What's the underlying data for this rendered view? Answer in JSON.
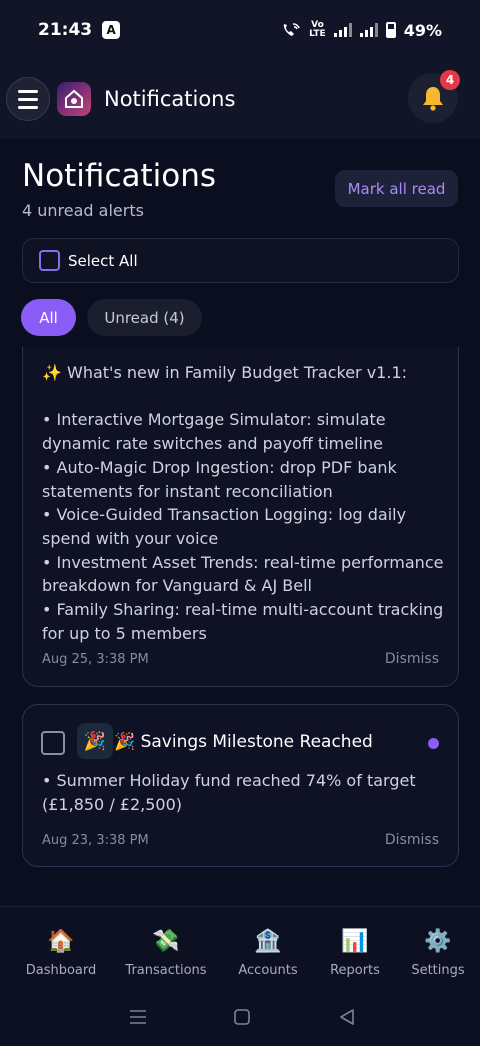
{
  "status": {
    "time": "21:43",
    "notif_app_icon": "A",
    "volte": "Vo\nLTE",
    "battery": "49%"
  },
  "header": {
    "title": "Notifications",
    "bell_badge": "4",
    "menu_icon": "hamburger-icon",
    "bell_icon": "bell-icon"
  },
  "page": {
    "title": "Notifications",
    "subtitle": "4 unread alerts",
    "mark_all_read": "Mark all read",
    "select_all": "Select All",
    "filters": {
      "all": "All",
      "unread": "Unread (4)"
    }
  },
  "notifications": [
    {
      "lines": [
        "✨ What's new in Family Budget Tracker v1.1:",
        "",
        "• Interactive Mortgage Simulator: simulate dynamic rate switches and payoff timeline",
        "• Auto-Magic Drop Ingestion: drop PDF bank statements for instant reconciliation",
        "• Voice-Guided Transaction Logging: log daily spend with your voice",
        "• Investment Asset Trends: real-time performance breakdown for Vanguard & AJ Bell",
        "• Family Sharing: real-time multi-account tracking for up to 5 members"
      ],
      "time": "Aug 25, 3:38 PM",
      "dismiss": "Dismiss"
    },
    {
      "emoji": "🎉",
      "title": "🎉 Savings Milestone Reached",
      "body": "• Summer Holiday fund reached 74% of target (£1,850 / £2,500)",
      "time": "Aug 23, 3:38 PM",
      "dismiss": "Dismiss"
    }
  ],
  "nav": [
    {
      "label": "Dashboard",
      "icon": "🏠"
    },
    {
      "label": "Transactions",
      "icon": "💸"
    },
    {
      "label": "Accounts",
      "icon": "🏦"
    },
    {
      "label": "Reports",
      "icon": "📊"
    },
    {
      "label": "Settings",
      "icon": "⚙️"
    }
  ],
  "colors": {
    "accent": "#8b5cf6",
    "badge": "#e53945",
    "background": "#0b0e1e"
  }
}
